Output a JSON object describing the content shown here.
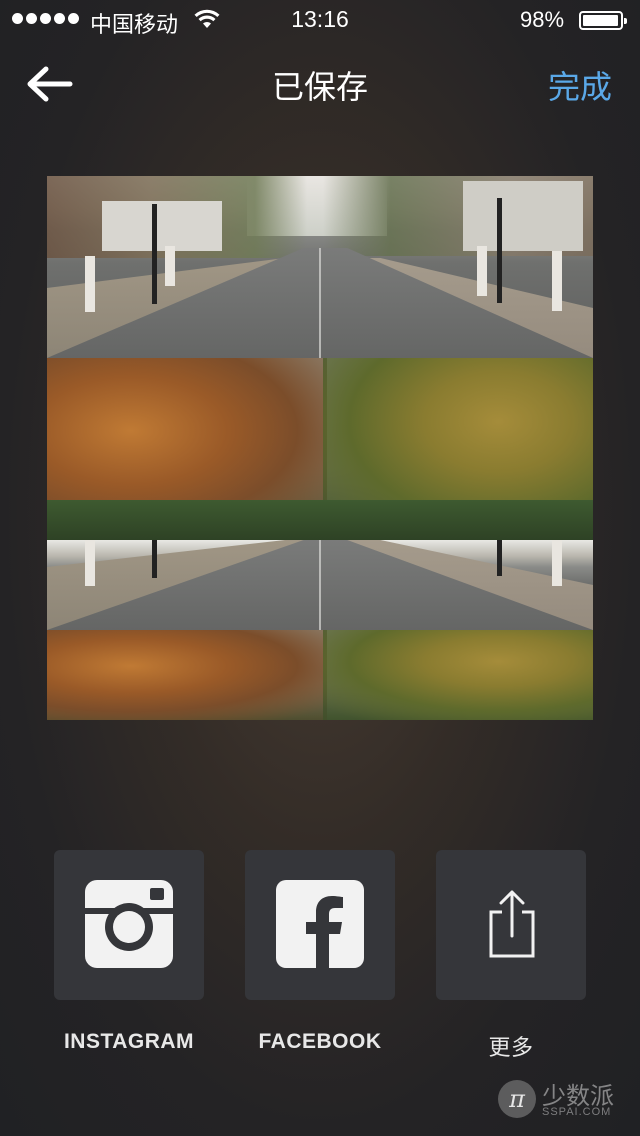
{
  "status_bar": {
    "carrier": "中国移动",
    "time": "13:16",
    "battery_percent": "98%",
    "battery_level": 0.98,
    "signal_bars": 5
  },
  "nav": {
    "title": "已保存",
    "done_label": "完成",
    "done_color": "#5aa8e8"
  },
  "share": {
    "items": [
      {
        "label": "INSTAGRAM",
        "icon": "instagram-icon"
      },
      {
        "label": "FACEBOOK",
        "icon": "facebook-icon"
      },
      {
        "label": "更多",
        "icon": "share-icon"
      }
    ]
  },
  "watermark": {
    "name": "少数派",
    "url": "SSPAI.COM"
  }
}
